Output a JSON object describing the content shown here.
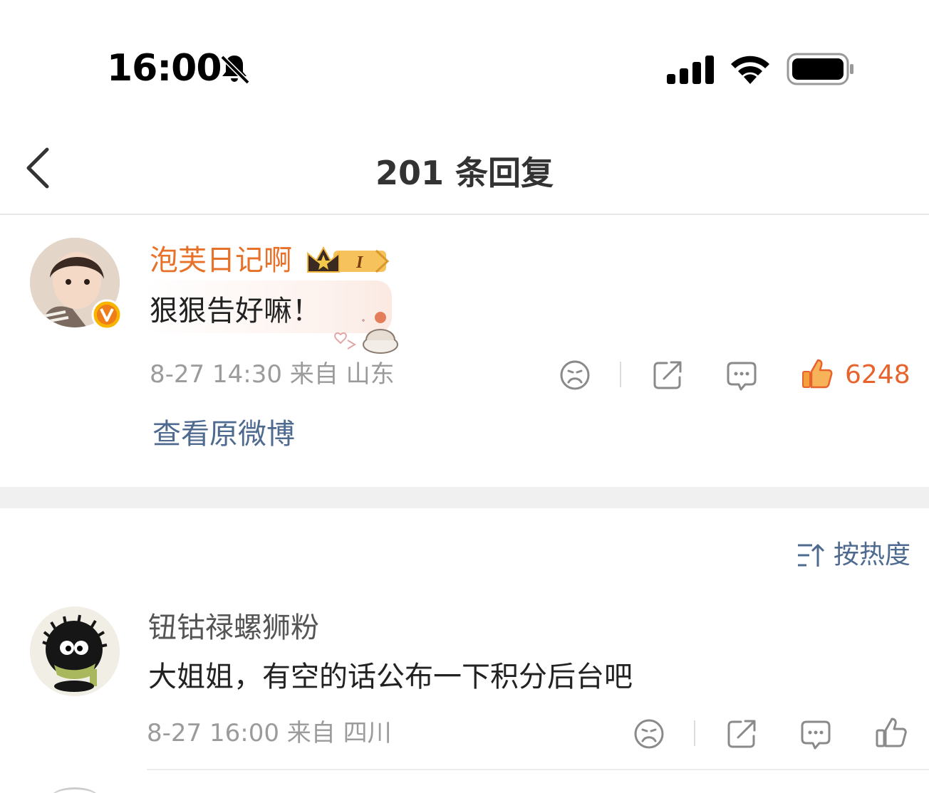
{
  "status_bar": {
    "time": "16:00",
    "icons": [
      "bell-slash-icon",
      "cellular-signal-icon",
      "wifi-icon",
      "battery-icon"
    ]
  },
  "nav": {
    "title": "201 条回复",
    "back_icon": "chevron-left-icon"
  },
  "main_comment": {
    "username": "泡芙日记啊",
    "username_color": "#e8712a",
    "text": "狠狠告好嘛！",
    "meta": "8-27 14:30  来自 山东",
    "like_count": "6248",
    "like_color": "#e8632c",
    "view_original": "查看原微博",
    "icons": [
      "dislike-face-icon",
      "share-icon",
      "comment-icon",
      "thumbs-up-icon"
    ]
  },
  "sort": {
    "label": "按热度",
    "icon": "sort-icon"
  },
  "replies": [
    {
      "username": "钮钴禄螺狮粉",
      "text": "大姐姐，有空的话公布一下积分后台吧",
      "meta": "8-27 16:00  来自 四川",
      "icons": [
        "dislike-face-icon",
        "share-icon",
        "comment-icon",
        "thumbs-up-icon"
      ]
    }
  ],
  "colors": {
    "link": "#4e6a8f",
    "meta_gray": "#9b9b9b",
    "band": "#f0f0f0"
  }
}
